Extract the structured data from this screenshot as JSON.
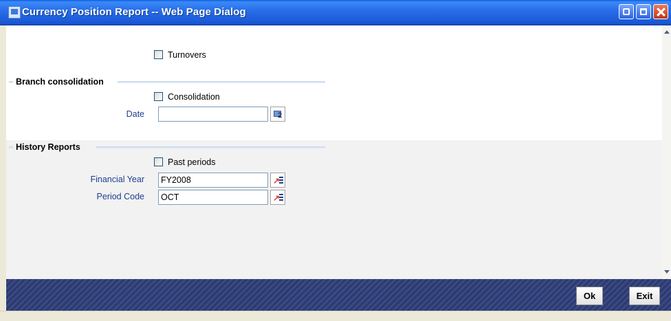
{
  "window": {
    "title": "Currency Position Report -- Web Page Dialog"
  },
  "form": {
    "turnovers_label": "Turnovers",
    "turnovers_checked": false,
    "branch_consolidation": {
      "title": "Branch consolidation",
      "consolidation_label": "Consolidation",
      "consolidation_checked": false,
      "date_label": "Date",
      "date_value": "",
      "calendar_icon": "calendar-icon"
    },
    "history_reports": {
      "title": "History Reports",
      "past_periods_label": "Past periods",
      "past_periods_checked": false,
      "financial_year_label": "Financial Year",
      "financial_year_value": "FY2008",
      "period_code_label": "Period Code",
      "period_code_value": "OCT",
      "lov_icon": "list-of-values-icon"
    }
  },
  "footer": {
    "ok_label": "Ok",
    "exit_label": "Exit"
  }
}
